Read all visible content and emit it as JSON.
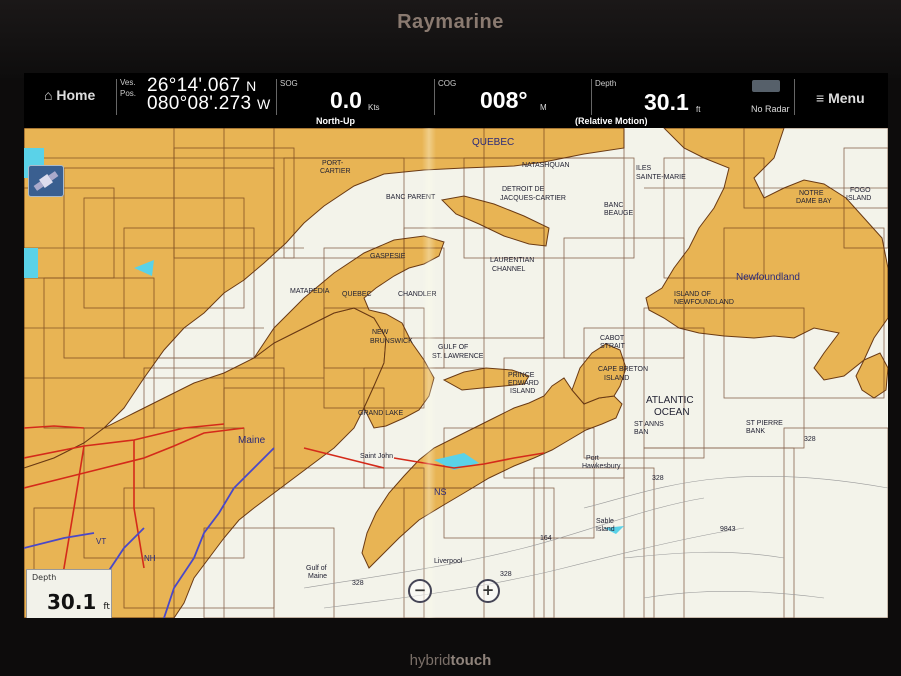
{
  "device": {
    "brand": "Raymarine",
    "model_prefix": "hybrid",
    "model_suffix": "touch"
  },
  "topbar": {
    "home_label": "Home",
    "pos_label_top": "Ves.",
    "pos_label_bottom": "Pos.",
    "latitude": "26°14'.067",
    "latitude_hemi": "N",
    "longitude": "080°08'.273",
    "longitude_hemi": "W",
    "sog_label": "SOG",
    "sog_value": "0.0",
    "sog_unit": "Kts",
    "orientation": "North-Up",
    "cog_label": "COG",
    "cog_value": "008°",
    "cog_unit": "M",
    "depth_label": "Depth",
    "depth_value": "30.1",
    "depth_unit": "ft",
    "motion_mode": "(Relative Motion)",
    "radar_label": "No Radar",
    "menu_label": "Menu"
  },
  "depth_box": {
    "label": "Depth",
    "value": "30.1",
    "unit": "ft"
  },
  "map_labels": {
    "quebec": "QUEBEC",
    "port_cartier": "PORT-",
    "port_cartier_2": "CARTIER",
    "natashquan": "NATASHQUAN",
    "iles": "ILES",
    "sainte_marie": "SAINTE-MARIE",
    "banc_parent": "BANC PARENT",
    "detroit": "DETROIT DE",
    "jacques_cartier": "JACQUES-CARTIER",
    "banc_beaugé": "BANC",
    "banc_beaugé_2": "BEAUGE",
    "notre_dame": "NOTRE",
    "notre_dame_2": "DAME BAY",
    "fogo": "FOGO",
    "fogo_2": "ISLAND",
    "gaspesie": "GASPESIE",
    "laurentian": "LAURENTIAN",
    "laurentian_2": "CHANNEL",
    "newfoundland": "Newfoundland",
    "island_of": "ISLAND OF",
    "island_of_2": "NEWFOUNDLAND",
    "matapedia": "MATAPEDIA",
    "quebec_small": "QUEBEC",
    "chandler": "CHANDLER",
    "new_brunswick": "NEW",
    "new_brunswick_2": "BRUNSWICK",
    "gulf_st_lawrence": "GULF OF",
    "gulf_st_lawrence_2": "ST. LAWRENCE",
    "cabot": "CABOT",
    "cabot_2": "STRAIT",
    "pei": "PRINCE",
    "pei_2": "EDWARD",
    "pei_3": "ISLAND",
    "cape_breton": "CAPE BRETON",
    "cape_breton_2": "ISLAND",
    "atlantic": "ATLANTIC",
    "atlantic_2": "OCEAN",
    "st_pierre": "ST PIERRE",
    "st_pierre_2": "BANK",
    "st_annes": "ST ANNS",
    "st_annes_2": "BAN",
    "maine": "Maine",
    "grand_lake": "GRAND LAKE",
    "saint_john": "Saint John",
    "ns": "NS",
    "port_hawkesbury": "Port",
    "port_hawkesbury_2": "Hawkesbury",
    "sable": "Sable",
    "sable_2": "Island",
    "liverpool": "Liverpool",
    "gulf_maine": "Gulf of",
    "gulf_maine_2": "Maine",
    "vt": "VT",
    "nh": "NH",
    "depth_328": "328",
    "depth_164": "164",
    "depth_9843": "9843",
    "depth_328b": "328",
    "depth_328c": "328",
    "depth_328d": "328"
  },
  "colors": {
    "land": "#e8b454",
    "water": "#f3f3ea",
    "chart_border": "#5a2a10",
    "road": "#d42a1a",
    "highway": "#4a48c8",
    "lake": "#5ad2e8"
  },
  "icons": {
    "gps": "gps-satellite-icon",
    "zoom_out": "zoom-out-icon",
    "zoom_in": "zoom-in-icon",
    "home": "home-icon",
    "menu": "menu-icon",
    "radar": "radar-icon"
  }
}
